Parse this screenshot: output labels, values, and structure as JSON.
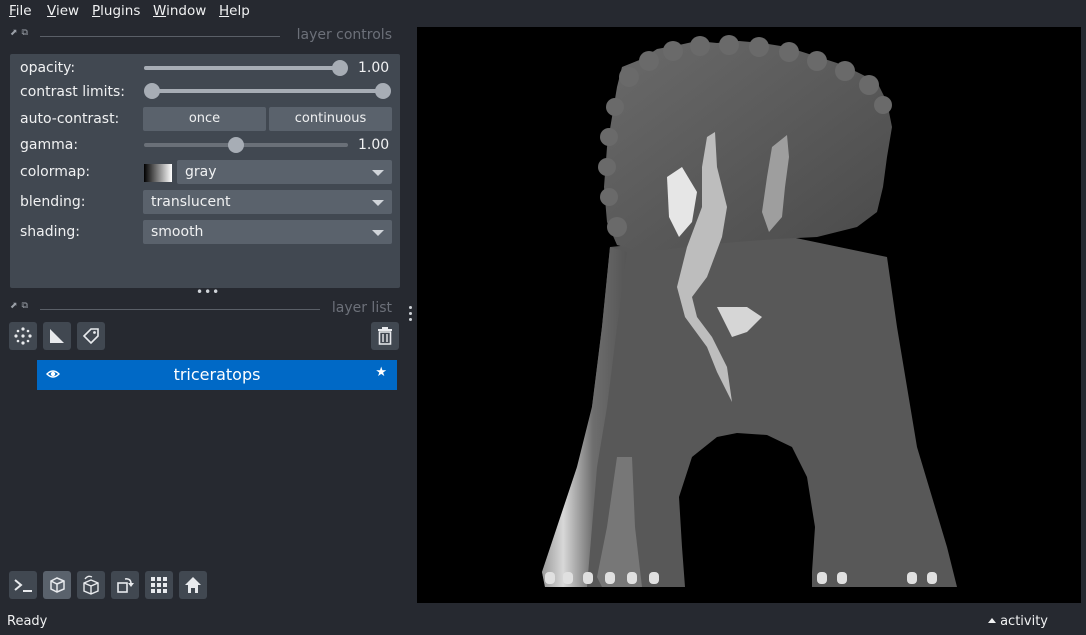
{
  "menubar": {
    "file": {
      "accel": "F",
      "rest": "ile"
    },
    "view": {
      "accel": "V",
      "rest": "iew"
    },
    "plugins": {
      "accel": "P",
      "rest": "lugins"
    },
    "window": {
      "accel": "W",
      "rest": "indow"
    },
    "help": {
      "accel": "H",
      "rest": "elp"
    }
  },
  "layer_controls": {
    "title": "layer controls",
    "opacity": {
      "label": "opacity:",
      "value_text": "1.00",
      "fraction": 1.0
    },
    "contrast_limits": {
      "label": "contrast limits:",
      "low_fraction": 0.0,
      "high_fraction": 1.0
    },
    "auto_contrast": {
      "label": "auto-contrast:",
      "once": "once",
      "continuous": "continuous"
    },
    "gamma": {
      "label": "gamma:",
      "value_text": "1.00",
      "fraction": 0.45
    },
    "colormap": {
      "label": "colormap:",
      "value": "gray"
    },
    "blending": {
      "label": "blending:",
      "value": "translucent"
    },
    "shading": {
      "label": "shading:",
      "value": "smooth"
    }
  },
  "layer_list": {
    "title": "layer list",
    "layers": [
      {
        "name": "triceratops",
        "visible": true,
        "selected": true
      }
    ]
  },
  "status": {
    "text": "Ready",
    "activity": "activity"
  },
  "colors": {
    "background": "#262930",
    "panel": "#414851",
    "selection": "#0069c6",
    "canvas": "#000000"
  },
  "icons": {
    "points": "points-icon",
    "shapes": "shapes-icon",
    "labels": "labels-icon",
    "delete": "trash-icon",
    "console": "console-icon",
    "ndisplay": "3d-cube-icon",
    "roll": "roll-icon",
    "transpose": "transpose-icon",
    "grid": "grid-icon",
    "home": "home-icon"
  }
}
